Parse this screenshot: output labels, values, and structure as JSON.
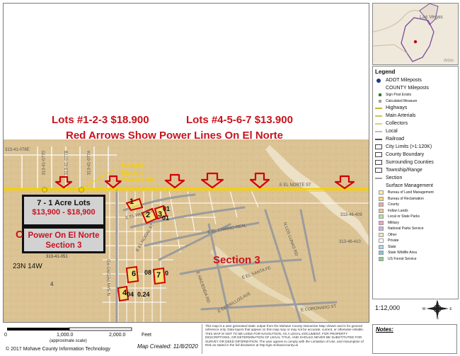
{
  "headlines": {
    "lots_a": "Lots #1-2-3 $18.900",
    "lots_b": "Lots #4-5-6-7 $13.900",
    "arrows": "Red Arrows Show Power Lines On El Norte"
  },
  "box_acre": {
    "line1": "7 - 1 Acre Lots",
    "line2": "$13,900 - $18,900"
  },
  "box_power": {
    "line1": "Power On El Norte",
    "line2": "Section 3"
  },
  "c_letter": "C",
  "section_label": "Section 3",
  "township": "23N 14W",
  "mohave_label": {
    "l1": "Mohave",
    "l2": "Electric",
    "l3": "Power Line"
  },
  "lot_labels": [
    "1",
    "01",
    "2",
    "3",
    "01",
    "6",
    "08",
    "7",
    "0",
    "4",
    "04",
    "0.24"
  ],
  "road_labels": {
    "el_norte": "E EL NORTE ST",
    "el_paso": "E EL PASO ST",
    "el_camino_real": "E EL CAMINO REAL",
    "el_nogal": "E EL NOGAL ST",
    "san_pedro": "N SAN PEDRO RD",
    "santa_fe": "E EL SANTA FE",
    "cerrillos": "E CERRILLOS AVE",
    "los_lunas": "N LOS LUNAS RD",
    "coronado": "E CORONADO ST",
    "hacienda": "E HACIENDA RD"
  },
  "parcel_ids": {
    "p1": "313-41-078E",
    "p2": "313-41-077D",
    "p3": "313-41-077B",
    "p4": "313-41-077A",
    "p5": "313-46-409",
    "p6": "313-46-410",
    "p7": "313-41-051",
    "p8": "4"
  },
  "scale": {
    "t0": "0",
    "t1": "1,000.0",
    "t2": "2,000.0",
    "unit": "Feet",
    "note": "(approximate scale)"
  },
  "copyright": "© 2017 Mohave County Information Technology",
  "map_created": "Map Created: 11/8/2020",
  "disclaimer": "This map is a user generated static output from the Mohave County Interactive Map Viewer and is for general reference only. Data layers that appear on this map may or may not be accurate, current, or otherwise reliable. THIS MAP IS NOT TO BE USED FOR NAVIGATION, AS A LEGAL DOCUMENT, FOR PROPERTY DESCRIPTIONS, OR DETERMINATION OF LEGAL TITLE, AND SHOULD NEVER BE SUBSTITUTED FOR SURVEY OR DEED INFORMATION. The user agrees to comply with the Limitation of Use, and Assumption of Risk as stated in the full disclaimer at http://gis.mohavecounty.us",
  "inset": {
    "city": "Las Vegas",
    "place2": "Arizo"
  },
  "legend": {
    "title": "Legend",
    "items": [
      {
        "label": "ADOT Mileposts",
        "kind": "dot",
        "color": "#1e3a8a"
      },
      {
        "label": "COUNTY Mileposts",
        "kind": "none"
      },
      {
        "label": "Sign Post Exists",
        "kind": "subdot",
        "color": "#2e7d32"
      },
      {
        "label": "Calculated Measure",
        "kind": "subdot",
        "color": "#9e9e9e"
      },
      {
        "label": "Highways",
        "kind": "line",
        "color": "#c9b531"
      },
      {
        "label": "Main Arterials",
        "kind": "line",
        "color": "#cfc05a"
      },
      {
        "label": "Collectors",
        "kind": "line",
        "color": "#d9cf84"
      },
      {
        "label": "Local",
        "kind": "line",
        "color": "#bdbdbd"
      },
      {
        "label": "Railroad",
        "kind": "line",
        "color": "#555555"
      },
      {
        "label": "City Limits (>1:120K)",
        "kind": "box"
      },
      {
        "label": "County Boundary",
        "kind": "box"
      },
      {
        "label": "Surrounding Counties",
        "kind": "box"
      },
      {
        "label": "Township/Range",
        "kind": "box"
      },
      {
        "label": "Section",
        "kind": "line",
        "color": "#9e9e9e"
      },
      {
        "label": "Surface Management",
        "kind": "none"
      },
      {
        "label": "Bureau of Land Management",
        "kind": "sq",
        "color": "#fde9a8"
      },
      {
        "label": "Bureau of Reclamation",
        "kind": "sq",
        "color": "#f7d27a"
      },
      {
        "label": "County",
        "kind": "sq",
        "color": "#e8a9a9"
      },
      {
        "label": "Indian Lands",
        "kind": "sq",
        "color": "#f4c28c"
      },
      {
        "label": "Local or State Parks",
        "kind": "sq",
        "color": "#b9dca6"
      },
      {
        "label": "Military",
        "kind": "sq",
        "color": "#f2a1c0"
      },
      {
        "label": "National Parks Service",
        "kind": "sq",
        "color": "#c7b6e0"
      },
      {
        "label": "Other",
        "kind": "sq",
        "color": "#f3e2c3"
      },
      {
        "label": "Private",
        "kind": "sq",
        "color": "#ffffff"
      },
      {
        "label": "State",
        "kind": "sq",
        "color": "#a9d4ea"
      },
      {
        "label": "State Wildlife Area",
        "kind": "sq",
        "color": "#86c3e3"
      },
      {
        "label": "US Forest Service",
        "kind": "sq",
        "color": "#8fd08a"
      }
    ]
  },
  "ratio": "1:12,000",
  "compass": {
    "n": "N",
    "s": "S",
    "e": "E",
    "w": "W"
  },
  "notes_label": "Notes:",
  "colors": {
    "accent_red": "#c8141e",
    "power_line": "#f3d100",
    "terrain": "#ddc496",
    "lot_outline": "#d10000"
  }
}
